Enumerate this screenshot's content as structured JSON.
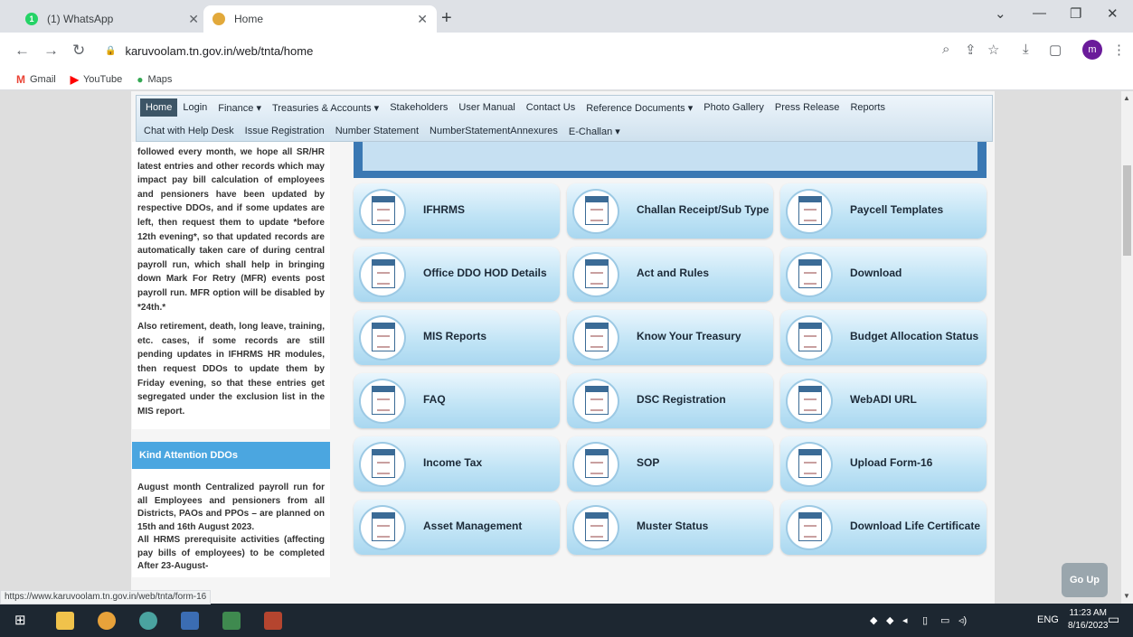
{
  "browser": {
    "tabs": [
      {
        "title": "(1) WhatsApp",
        "active": false
      },
      {
        "title": "Home",
        "active": true
      }
    ],
    "url": "karuvoolam.tn.gov.in/web/tnta/home",
    "bookmarks": [
      {
        "label": "Gmail",
        "icon": "gmail-icon"
      },
      {
        "label": "YouTube",
        "icon": "youtube-icon"
      },
      {
        "label": "Maps",
        "icon": "maps-icon"
      }
    ],
    "profile_initial": "m",
    "status_url": "https://www.karuvoolam.tn.gov.in/web/tnta/form-16"
  },
  "nav": {
    "row1": [
      "Home",
      "Login",
      "Finance ▾",
      "Treasuries & Accounts ▾",
      "Stakeholders",
      "User Manual",
      "Contact Us",
      "Reference Documents ▾",
      "Photo Gallery",
      "Press Release",
      "Reports"
    ],
    "row2": [
      "Chat with Help Desk",
      "Issue Registration",
      "Number Statement",
      "NumberStatementAnnexures",
      "E-Challan ▾"
    ]
  },
  "sidebar": {
    "para1": "followed every month, we hope all SR/HR latest entries and other records which may impact pay bill calculation of employees and pensioners have been updated by respective DDOs, and if some updates are left, then request them to update *before 12th evening*, so that updated records are automatically taken care of during central payroll run, which shall help in bringing down Mark For Retry (MFR) events post payroll run. MFR option will be disabled by *24th.*",
    "para2": "Also retirement, death, long leave, training, etc. cases, if some records are still pending updates in IFHRMS HR modules, then request DDOs to update them by Friday evening, so that these entries get segregated under the exclusion list in the MIS report.",
    "heading": "Kind Attention DDOs",
    "para3": "August month Centralized payroll run for all Employees and pensioners from all Districts, PAOs and PPOs – are planned on 15th and 16th August 2023.",
    "para4": "All HRMS prerequisite activities (affecting pay bills of employees) to be completed After 23-August-"
  },
  "tiles": [
    [
      "IFHRMS",
      "Challan Receipt/Sub Type",
      "Paycell Templates"
    ],
    [
      "Office DDO HOD Details",
      "Act and Rules",
      "Download"
    ],
    [
      "MIS Reports",
      "Know Your Treasury",
      "Budget Allocation Status"
    ],
    [
      "FAQ",
      "DSC Registration",
      "WebADI URL"
    ],
    [
      "Income Tax",
      "SOP",
      "Upload Form-16"
    ],
    [
      "Asset Management",
      "Muster Status",
      "Download Life Certificate"
    ]
  ],
  "go_up": "Go Up",
  "taskbar": {
    "lang": "ENG",
    "time": "11:23 AM",
    "date": "8/16/2023"
  }
}
